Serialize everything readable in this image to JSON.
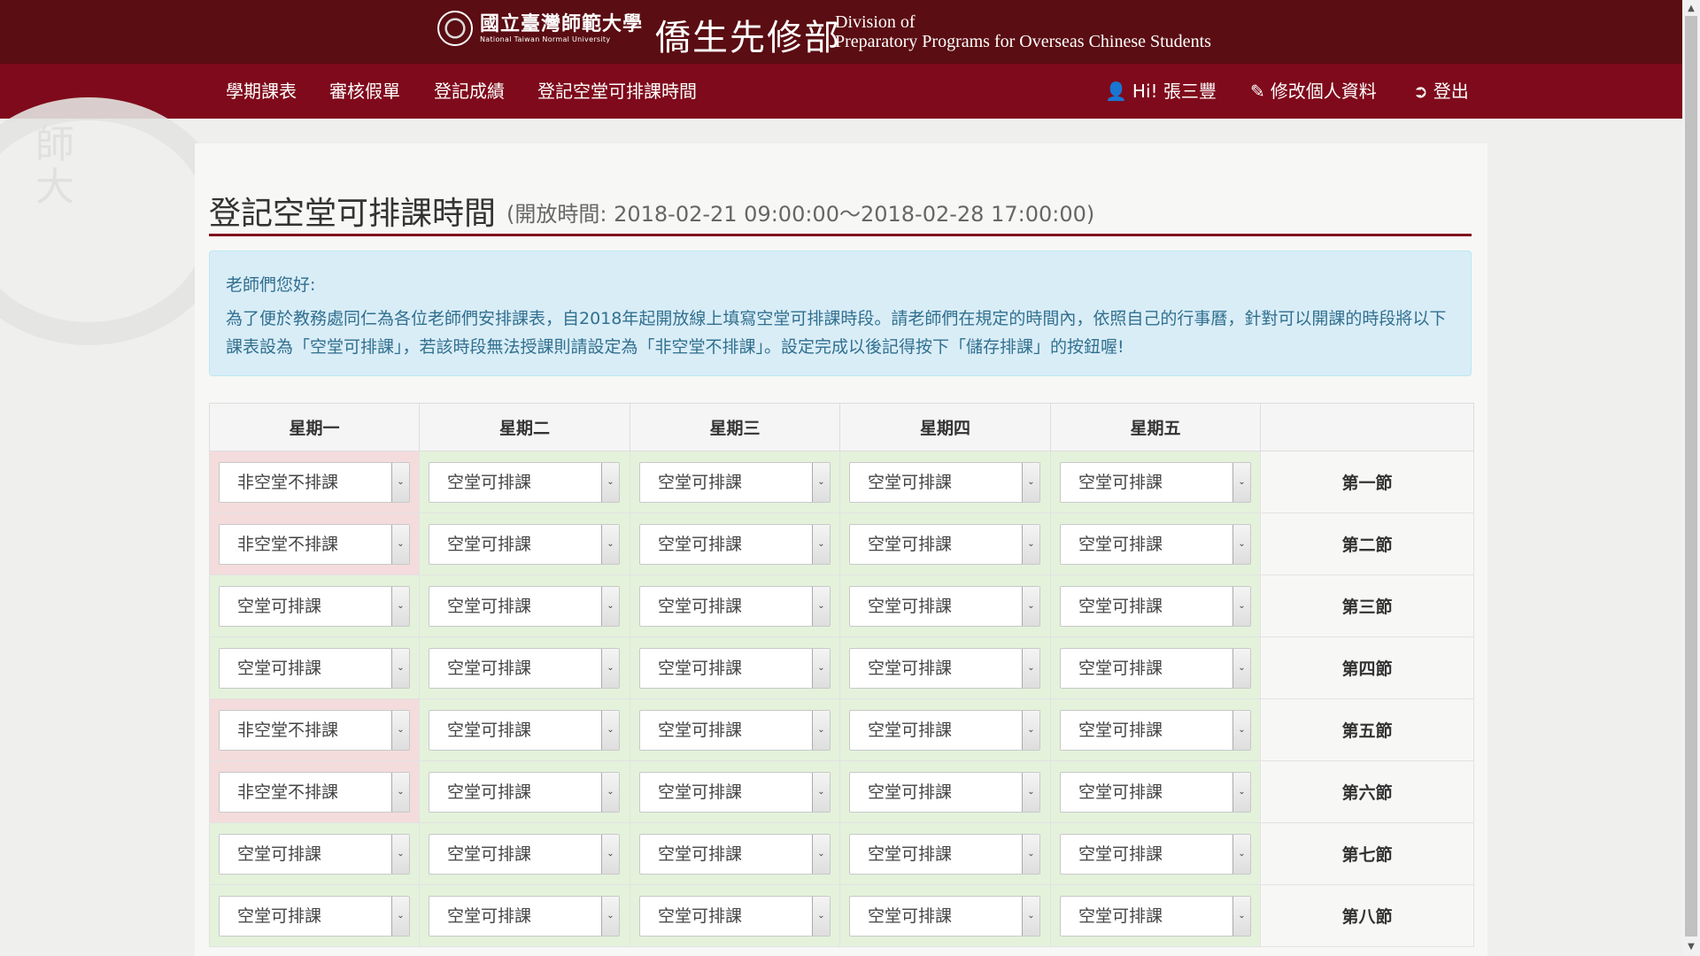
{
  "header": {
    "ntnu_zh": "國立臺灣師範大學",
    "ntnu_en": "National Taiwan Normal University",
    "dept_zh": "僑生先修部",
    "dept_en_line1": "Division of",
    "dept_en_line2": "Preparatory Programs for Overseas Chinese Students"
  },
  "nav": {
    "left": [
      "學期課表",
      "審核假單",
      "登記成績",
      "登記空堂可排課時間"
    ],
    "greeting": "Hi!  張三豐",
    "edit_profile": "修改個人資料",
    "logout": "登出"
  },
  "page": {
    "title": "登記空堂可排課時間",
    "open_time": "(開放時間: 2018-02-21 09:00:00～2018-02-28 17:00:00)"
  },
  "notice": {
    "greeting": "老師們您好:",
    "body": "為了便於教務處同仁為各位老師們安排課表，自2018年起開放線上填寫空堂可排課時段。請老師們在規定的時間內，依照自己的行事曆，針對可以開課的時段將以下課表設為「空堂可排課」，若該時段無法授課則請設定為「非空堂不排課」。設定完成以後記得按下「儲存排課」的按鈕喔!"
  },
  "schedule": {
    "days": [
      "星期一",
      "星期二",
      "星期三",
      "星期四",
      "星期五"
    ],
    "periods": [
      "第一節",
      "第二節",
      "第三節",
      "第四節",
      "第五節",
      "第六節",
      "第七節",
      "第八節"
    ],
    "rows": [
      [
        "非空堂不排課",
        "空堂可排課",
        "空堂可排課",
        "空堂可排課",
        "空堂可排課"
      ],
      [
        "非空堂不排課",
        "空堂可排課",
        "空堂可排課",
        "空堂可排課",
        "空堂可排課"
      ],
      [
        "空堂可排課",
        "空堂可排課",
        "空堂可排課",
        "空堂可排課",
        "空堂可排課"
      ],
      [
        "空堂可排課",
        "空堂可排課",
        "空堂可排課",
        "空堂可排課",
        "空堂可排課"
      ],
      [
        "非空堂不排課",
        "空堂可排課",
        "空堂可排課",
        "空堂可排課",
        "空堂可排課"
      ],
      [
        "非空堂不排課",
        "空堂可排課",
        "空堂可排課",
        "空堂可排課",
        "空堂可排課"
      ],
      [
        "空堂可排課",
        "空堂可排課",
        "空堂可排課",
        "空堂可排課",
        "空堂可排課"
      ],
      [
        "空堂可排課",
        "空堂可排課",
        "空堂可排課",
        "空堂可排課",
        "空堂可排課"
      ]
    ],
    "unavailable_value": "非空堂不排課"
  },
  "colors": {
    "banner": "#5a0d12",
    "navbar": "#7f0a1b",
    "available_cell": "#e4f2dc",
    "unavailable_cell": "#f4dcdc",
    "notice_bg": "#d9edf7"
  }
}
